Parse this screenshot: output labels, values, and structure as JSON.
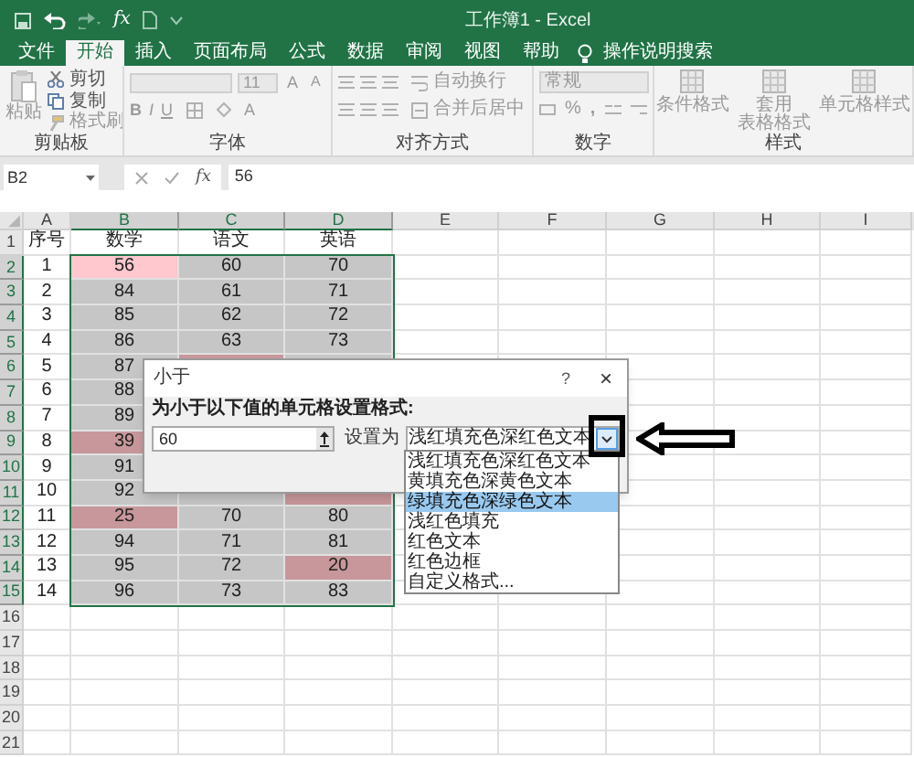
{
  "window": {
    "title": "工作簿1 - Excel"
  },
  "quick_access": {
    "formula_glyph": "fx"
  },
  "tabs": [
    {
      "label": "文件",
      "selected": false
    },
    {
      "label": "开始",
      "selected": true
    },
    {
      "label": "插入",
      "selected": false
    },
    {
      "label": "页面布局",
      "selected": false
    },
    {
      "label": "公式",
      "selected": false
    },
    {
      "label": "数据",
      "selected": false
    },
    {
      "label": "审阅",
      "selected": false
    },
    {
      "label": "视图",
      "selected": false
    },
    {
      "label": "帮助",
      "selected": false
    }
  ],
  "tell_me": "操作说明搜索",
  "ribbon": {
    "clipboard": {
      "label": "剪贴板",
      "paste": "粘贴",
      "cut": "剪切",
      "copy": "复制",
      "format_painter": "格式刷"
    },
    "font": {
      "label": "字体",
      "size": "11",
      "grow": "A",
      "shrink": "A",
      "bold": "B",
      "italic": "I",
      "underline": "U",
      "tint": "A"
    },
    "alignment": {
      "label": "对齐方式",
      "wrap": "自动换行",
      "merge": "合并后居中"
    },
    "number": {
      "label": "数字",
      "format": "常规",
      "percent": "%",
      "comma": ","
    },
    "styles": {
      "label": "样式",
      "conditional": "条件格式",
      "table": [
        "套用",
        "表格格式"
      ],
      "cell": "单元格样式"
    }
  },
  "formula_bar": {
    "name_box": "B2",
    "fx": "fx",
    "value": "56"
  },
  "sheet": {
    "columns": [
      {
        "label": "A",
        "selected": false
      },
      {
        "label": "B",
        "selected": true
      },
      {
        "label": "C",
        "selected": true
      },
      {
        "label": "D",
        "selected": true
      },
      {
        "label": "E",
        "selected": false
      },
      {
        "label": "F",
        "selected": false
      },
      {
        "label": "G",
        "selected": false
      },
      {
        "label": "H",
        "selected": false
      },
      {
        "label": "I",
        "selected": false
      }
    ],
    "rows": [
      {
        "header": "1",
        "selected": false,
        "cells": [
          {
            "text": "序号",
            "kind": "plain"
          },
          {
            "text": "数学",
            "kind": "plain"
          },
          {
            "text": "语文",
            "kind": "plain"
          },
          {
            "text": "英语",
            "kind": "plain"
          }
        ]
      },
      {
        "header": "2",
        "selected": true,
        "cells": [
          {
            "text": "1",
            "kind": "plain"
          },
          {
            "text": "56",
            "kind": "active"
          },
          {
            "text": "60",
            "kind": "range"
          },
          {
            "text": "70",
            "kind": "range"
          }
        ]
      },
      {
        "header": "3",
        "selected": true,
        "cells": [
          {
            "text": "2",
            "kind": "plain"
          },
          {
            "text": "84",
            "kind": "range"
          },
          {
            "text": "61",
            "kind": "range"
          },
          {
            "text": "71",
            "kind": "range"
          }
        ]
      },
      {
        "header": "4",
        "selected": true,
        "cells": [
          {
            "text": "3",
            "kind": "plain"
          },
          {
            "text": "85",
            "kind": "range"
          },
          {
            "text": "62",
            "kind": "range"
          },
          {
            "text": "72",
            "kind": "range"
          }
        ]
      },
      {
        "header": "5",
        "selected": true,
        "cells": [
          {
            "text": "4",
            "kind": "plain"
          },
          {
            "text": "86",
            "kind": "range"
          },
          {
            "text": "63",
            "kind": "range"
          },
          {
            "text": "73",
            "kind": "range"
          }
        ]
      },
      {
        "header": "6",
        "selected": true,
        "cells": [
          {
            "text": "5",
            "kind": "plain"
          },
          {
            "text": "87",
            "kind": "range"
          },
          {
            "kind": "red"
          },
          {
            "kind": "range"
          }
        ]
      },
      {
        "header": "7",
        "selected": true,
        "cells": [
          {
            "text": "6",
            "kind": "plain"
          },
          {
            "text": "88",
            "kind": "range"
          },
          null,
          null
        ]
      },
      {
        "header": "8",
        "selected": true,
        "cells": [
          {
            "text": "7",
            "kind": "plain"
          },
          {
            "text": "89",
            "kind": "range"
          },
          null,
          null
        ]
      },
      {
        "header": "9",
        "selected": true,
        "cells": [
          {
            "text": "8",
            "kind": "plain"
          },
          {
            "text": "39",
            "kind": "red"
          },
          null,
          null
        ]
      },
      {
        "header": "10",
        "selected": true,
        "cells": [
          {
            "text": "9",
            "kind": "plain"
          },
          {
            "text": "91",
            "kind": "range"
          },
          null,
          null
        ]
      },
      {
        "header": "11",
        "selected": true,
        "cells": [
          {
            "text": "10",
            "kind": "plain"
          },
          {
            "text": "92",
            "kind": "range"
          },
          {
            "kind": "range"
          },
          {
            "kind": "red"
          }
        ]
      },
      {
        "header": "12",
        "selected": true,
        "cells": [
          {
            "text": "11",
            "kind": "plain"
          },
          {
            "text": "25",
            "kind": "red"
          },
          {
            "text": "70",
            "kind": "range"
          },
          {
            "text": "80",
            "kind": "range"
          }
        ]
      },
      {
        "header": "13",
        "selected": true,
        "cells": [
          {
            "text": "12",
            "kind": "plain"
          },
          {
            "text": "94",
            "kind": "range"
          },
          {
            "text": "71",
            "kind": "range"
          },
          {
            "text": "81",
            "kind": "range"
          }
        ]
      },
      {
        "header": "14",
        "selected": true,
        "cells": [
          {
            "text": "13",
            "kind": "plain"
          },
          {
            "text": "95",
            "kind": "range"
          },
          {
            "text": "72",
            "kind": "range"
          },
          {
            "text": "20",
            "kind": "red"
          }
        ]
      },
      {
        "header": "15",
        "selected": true,
        "cells": [
          {
            "text": "14",
            "kind": "plain"
          },
          {
            "text": "96",
            "kind": "range"
          },
          {
            "text": "73",
            "kind": "range"
          },
          {
            "text": "83",
            "kind": "range"
          }
        ]
      },
      {
        "header": "16",
        "selected": false
      },
      {
        "header": "17",
        "selected": false
      },
      {
        "header": "18",
        "selected": false
      },
      {
        "header": "19",
        "selected": false
      },
      {
        "header": "20",
        "selected": false
      },
      {
        "header": "21",
        "selected": false
      }
    ]
  },
  "dialog": {
    "title": "小于",
    "help": "?",
    "close": "×",
    "prompt": "为小于以下值的单元格设置格式:",
    "value": "60",
    "set_label": "设置为",
    "format": "浅红填充色深红色文本",
    "options": [
      {
        "label": "浅红填充色深红色文本",
        "selected": false
      },
      {
        "label": "黄填充色深黄色文本",
        "selected": false
      },
      {
        "label": "绿填充色深绿色文本",
        "selected": true
      },
      {
        "label": "浅红色填充",
        "selected": false
      },
      {
        "label": "红色文本",
        "selected": false
      },
      {
        "label": "红色边框",
        "selected": false
      },
      {
        "label": "自定义格式...",
        "selected": false
      }
    ]
  },
  "annotations": {
    "highlight_frame": true,
    "pointer_arrow": true
  }
}
